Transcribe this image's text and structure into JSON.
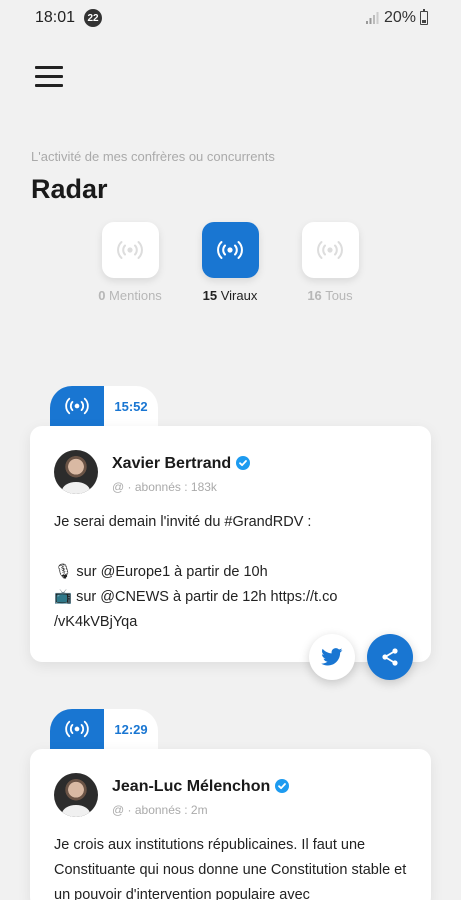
{
  "status_bar": {
    "time": "18:01",
    "notification_count": "22",
    "battery": "20%"
  },
  "header": {
    "subtitle": "L'activité de mes confrères ou concurrents",
    "title": "Radar"
  },
  "filters": [
    {
      "count": "0",
      "label": "Mentions",
      "active": false
    },
    {
      "count": "15",
      "label": "Viraux",
      "active": true
    },
    {
      "count": "16",
      "label": "Tous",
      "active": false
    }
  ],
  "tweets": [
    {
      "time": "15:52",
      "author": "Xavier Bertrand",
      "handle": "@ · abonnés : 183k",
      "text": "Je serai demain l'invité du #GrandRDV :\n\n🎙 sur @Europe1 à partir de 10h\n📺 sur @CNEWS à partir de 12h https://t.co\n/vK4kVBjYqa"
    },
    {
      "time": "12:29",
      "author": "Jean-Luc Mélenchon",
      "handle": "@ · abonnés : 2m",
      "text": "Je crois aux institutions républicaines. Il faut une Constituante qui nous donne une Constitution stable et un pouvoir d'intervention populaire avec"
    }
  ],
  "colors": {
    "accent": "#1976d2",
    "background": "#f1f1f1"
  },
  "icons": {
    "radar": "radar-broadcast-icon",
    "verified": "verified-badge-icon",
    "twitter": "twitter-bird-icon",
    "share": "share-icon",
    "menu": "hamburger-menu-icon"
  }
}
